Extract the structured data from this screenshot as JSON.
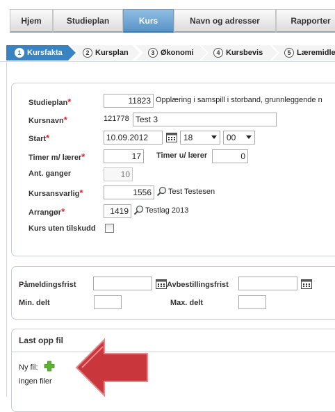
{
  "nav": {
    "tabs": [
      {
        "label": "Hjem",
        "active": false
      },
      {
        "label": "Studieplan",
        "active": false
      },
      {
        "label": "Kurs",
        "active": true
      },
      {
        "label": "Navn og adresser",
        "active": false
      },
      {
        "label": "Rapporter",
        "active": false
      }
    ]
  },
  "steps": [
    {
      "num": "1",
      "label": "Kursfakta",
      "active": true
    },
    {
      "num": "2",
      "label": "Kursplan",
      "active": false
    },
    {
      "num": "3",
      "label": "Økonomi",
      "active": false
    },
    {
      "num": "4",
      "label": "Kursbevis",
      "active": false
    },
    {
      "num": "5",
      "label": "Læremidle",
      "active": false
    }
  ],
  "form": {
    "studieplan": {
      "label": "Studieplan",
      "value": "11823",
      "description": "Opplæring i samspill i storband, grunnleggende n"
    },
    "kursnavn": {
      "label": "Kursnavn",
      "number": "121778",
      "value": "Test 3"
    },
    "start": {
      "label": "Start",
      "date": "10.09.2012",
      "hour": "18",
      "minute": "00"
    },
    "timer_m_laerer": {
      "label": "Timer m/ lærer",
      "value": "17"
    },
    "timer_u_laerer": {
      "label": "Timer u/ lærer",
      "value": "0"
    },
    "ant_ganger": {
      "label": "Ant. ganger",
      "value": "10"
    },
    "kursansvarlig": {
      "label": "Kursansvarlig",
      "value": "1556",
      "name": "Test Testesen"
    },
    "arrangor": {
      "label": "Arrangør",
      "value": "1419",
      "name": "Testlag 2013"
    },
    "kurs_uten_tilskudd": {
      "label": "Kurs uten tilskudd",
      "checked": false
    },
    "required_mark": "*"
  },
  "deadlines": {
    "pameldingsfrist": {
      "label": "Påmeldingsfrist",
      "value": ""
    },
    "avbestillingsfrist": {
      "label": "Avbestillingsfrist",
      "value": ""
    },
    "min_delt": {
      "label": "Min. delt",
      "value": ""
    },
    "max_delt": {
      "label": "Max. delt",
      "value": ""
    }
  },
  "upload": {
    "title": "Last opp fil",
    "new_file_label": "Ny fil:",
    "no_files": "ingen filer"
  },
  "colors": {
    "accent": "#3a83c3",
    "required": "#e0262c",
    "annotation_arrow": "#c9363b",
    "add_icon": "#5cb531"
  },
  "icons": [
    "calendar-icon",
    "search-icon",
    "add-icon",
    "annotation-arrow"
  ]
}
